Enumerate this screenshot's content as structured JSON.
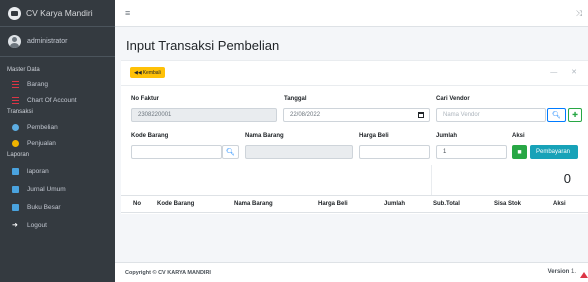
{
  "brand": {
    "name": "CV Karya Mandiri"
  },
  "user": {
    "name": "administrator"
  },
  "sidebar": {
    "headers": [
      "Master Data",
      "Transaksi",
      "Laporan"
    ],
    "master": [
      {
        "label": "Barang",
        "icon": "list-icon"
      },
      {
        "label": "Chart Of Account",
        "icon": "list-icon"
      }
    ],
    "transaksi": [
      {
        "label": "Pembelian",
        "icon": "circle-icon"
      },
      {
        "label": "Penjualan",
        "icon": "circle-icon"
      }
    ],
    "laporan": [
      {
        "label": "laporan",
        "icon": "book-icon"
      },
      {
        "label": "Jurnal Umum",
        "icon": "book-icon"
      },
      {
        "label": "Buku Besar",
        "icon": "book-icon"
      },
      {
        "label": "Logout",
        "icon": "logout-icon"
      }
    ]
  },
  "topbar": {
    "menu_glyph": "≡",
    "close_glyph": "⤨"
  },
  "page": {
    "title": "Input Transaksi Pembelian"
  },
  "card": {
    "back_label": "Kembali",
    "tools": "— ✕",
    "no_faktur": {
      "label": "No Faktur",
      "value": "2308220001"
    },
    "tanggal": {
      "label": "Tanggal",
      "value": "22/08/2022"
    },
    "vendor": {
      "label": "Cari Vendor",
      "placeholder": "Nama Vendor"
    },
    "kode_barang": {
      "label": "Kode Barang"
    },
    "nama_barang": {
      "label": "Nama Barang"
    },
    "harga_beli": {
      "label": "Harga Beli"
    },
    "jumlah": {
      "label": "Jumlah",
      "value": "1"
    },
    "aksi": {
      "label": "Aksi",
      "pay_label": "Pembayaran"
    },
    "total": "0",
    "table_headers": [
      "No",
      "Kode Barang",
      "Nama Barang",
      "Harga Beli",
      "Jumlah",
      "Sub.Total",
      "Sisa Stok",
      "Aksi"
    ]
  },
  "footer": {
    "copyright": "Copyright © CV KARYA MANDIRI",
    "version_label": "Version",
    "version": "1."
  },
  "colors": {
    "sidebar": "#343a40",
    "accent_blue": "#007bff",
    "success": "#28a745",
    "info": "#17a2b8",
    "warning": "#ffc107"
  }
}
